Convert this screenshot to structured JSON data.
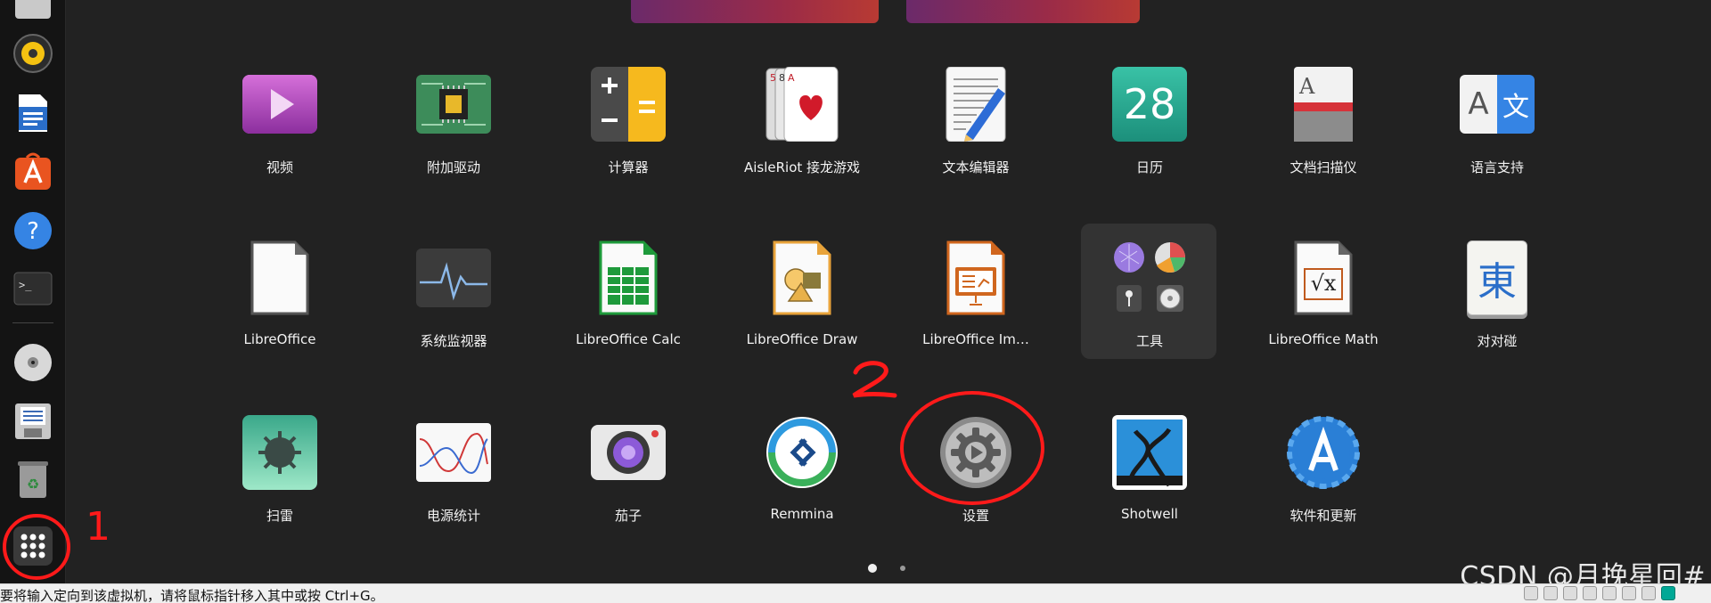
{
  "apps": [
    {
      "label": "视频",
      "icon": "video-icon"
    },
    {
      "label": "附加驱动",
      "icon": "chip-icon"
    },
    {
      "label": "计算器",
      "icon": "calculator-icon"
    },
    {
      "label": "AisleRiot 接龙游戏",
      "icon": "cards-icon"
    },
    {
      "label": "文本编辑器",
      "icon": "text-editor-icon"
    },
    {
      "label": "日历",
      "icon": "calendar-icon",
      "day": "28"
    },
    {
      "label": "文档扫描仪",
      "icon": "scanner-icon"
    },
    {
      "label": "语言支持",
      "icon": "language-icon",
      "glyph_a": "A",
      "glyph_b": "文"
    },
    {
      "label": "LibreOffice",
      "icon": "libreoffice-icon"
    },
    {
      "label": "系统监视器",
      "icon": "system-monitor-icon"
    },
    {
      "label": "LibreOffice Calc",
      "icon": "calc-icon"
    },
    {
      "label": "LibreOffice Draw",
      "icon": "draw-icon"
    },
    {
      "label": "LibreOffice Im…",
      "icon": "impress-icon"
    },
    {
      "label": "工具",
      "icon": "folder-icon"
    },
    {
      "label": "LibreOffice Math",
      "icon": "math-icon",
      "glyph": "√x"
    },
    {
      "label": "对对碰",
      "icon": "mahjong-icon",
      "glyph": "東"
    },
    {
      "label": "扫雷",
      "icon": "mines-icon"
    },
    {
      "label": "电源统计",
      "icon": "power-stats-icon"
    },
    {
      "label": "茄子",
      "icon": "camera-icon"
    },
    {
      "label": "Remmina",
      "icon": "remmina-icon"
    },
    {
      "label": "设置",
      "icon": "settings-icon"
    },
    {
      "label": "Shotwell",
      "icon": "shotwell-icon"
    },
    {
      "label": "软件和更新",
      "icon": "software-updates-icon"
    }
  ],
  "dock": {
    "items": [
      "files-icon",
      "rhythmbox-icon",
      "writer-icon",
      "app-center-icon",
      "help-icon",
      "terminal-icon",
      "disc-icon",
      "floppy-icon",
      "trash-icon",
      "show-apps-icon"
    ]
  },
  "annotations": {
    "one": "1",
    "two": "2"
  },
  "status_bar": {
    "text": "要将输入定向到该虚拟机，请将鼠标指针移入其中或按 Ctrl+G。"
  },
  "watermark": "CSDN @月挽星回#",
  "colors": {
    "accent_red": "#ff1a1a",
    "background": "#222222"
  }
}
